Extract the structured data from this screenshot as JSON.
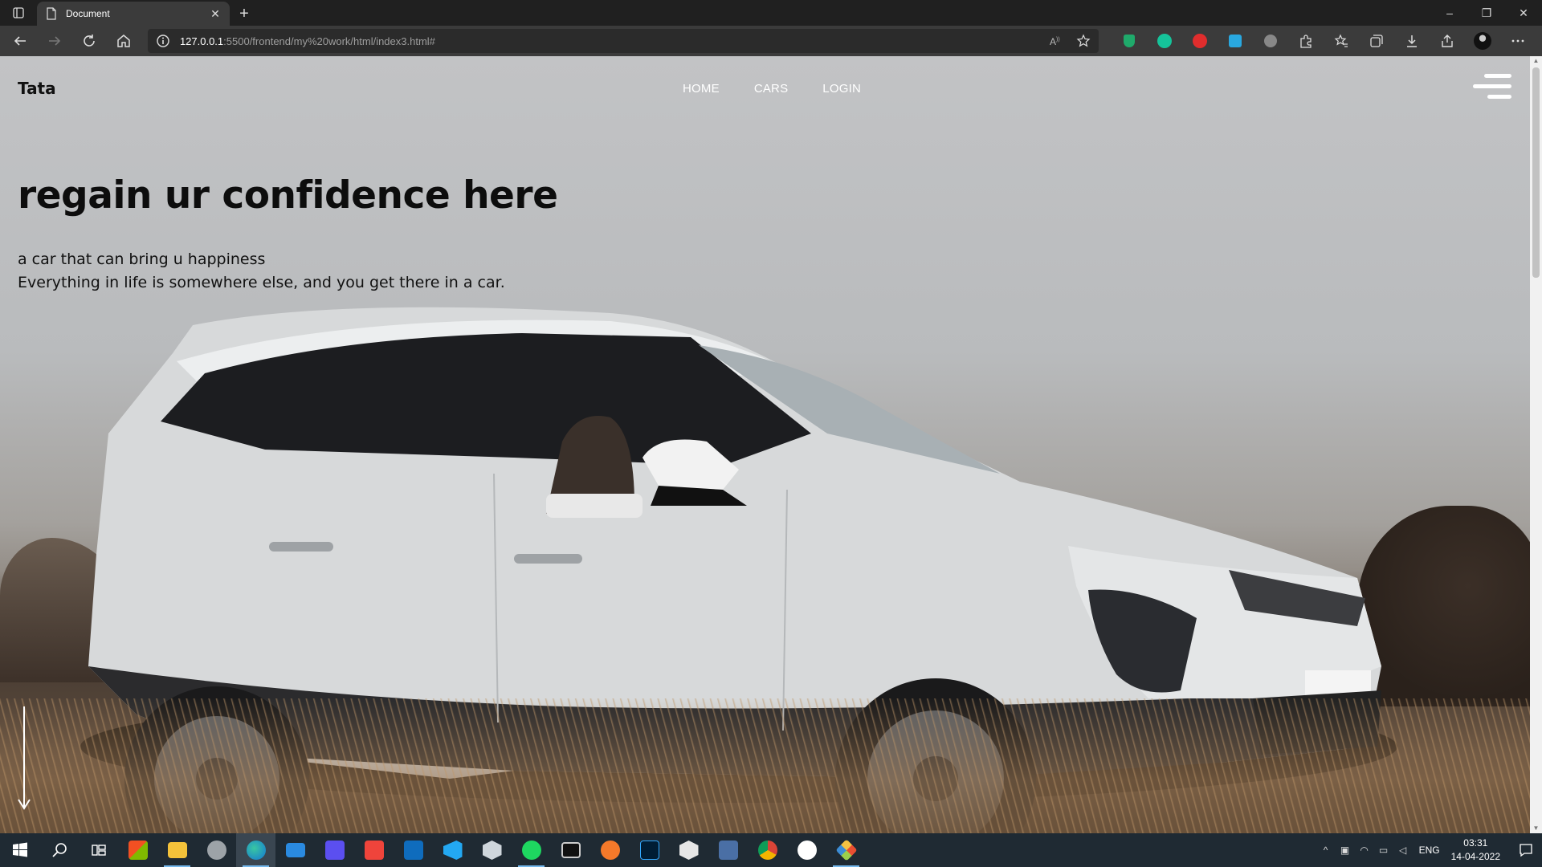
{
  "browser": {
    "tab_title": "Document",
    "tab_close": "✕",
    "new_tab": "+",
    "url_host": "127.0.0.1",
    "url_path": ":5500/frontend/my%20work/html/index3.html#",
    "window_controls": {
      "minimize": "–",
      "maximize": "❐",
      "close": "✕"
    }
  },
  "site": {
    "logo": "Tata",
    "nav": {
      "home": "HOME",
      "cars": "CARS",
      "login": "LOGIN"
    },
    "hero": {
      "title": "regain ur confidence here",
      "line1": "a car that can bring u happiness",
      "line2": "Everything in life is somewhere else, and you get there in a car."
    }
  },
  "taskbar": {
    "apps": [
      "start-icon",
      "search-icon",
      "task-view-icon",
      "store-icon",
      "file-explorer-icon",
      "disk-icon",
      "edge-icon",
      "mail-icon",
      "vscode-blue-icon",
      "anydesk-icon",
      "outlook-icon",
      "vscode-icon",
      "3d-icon",
      "spotify-icon",
      "terminal-icon",
      "blender-icon",
      "photoshop-icon",
      "unity-icon",
      "stuio-icon",
      "chrome-icon",
      "app-icon",
      "git-icon"
    ],
    "lang": "ENG",
    "time": "03:31",
    "date": "14-04-2022"
  },
  "colors": {
    "chrome_dark": "#202020",
    "toolbar": "#3b3b3b",
    "taskbar": "#1f2a33",
    "nav_text": "#ffffff",
    "hero_text": "#0d0d0d"
  }
}
